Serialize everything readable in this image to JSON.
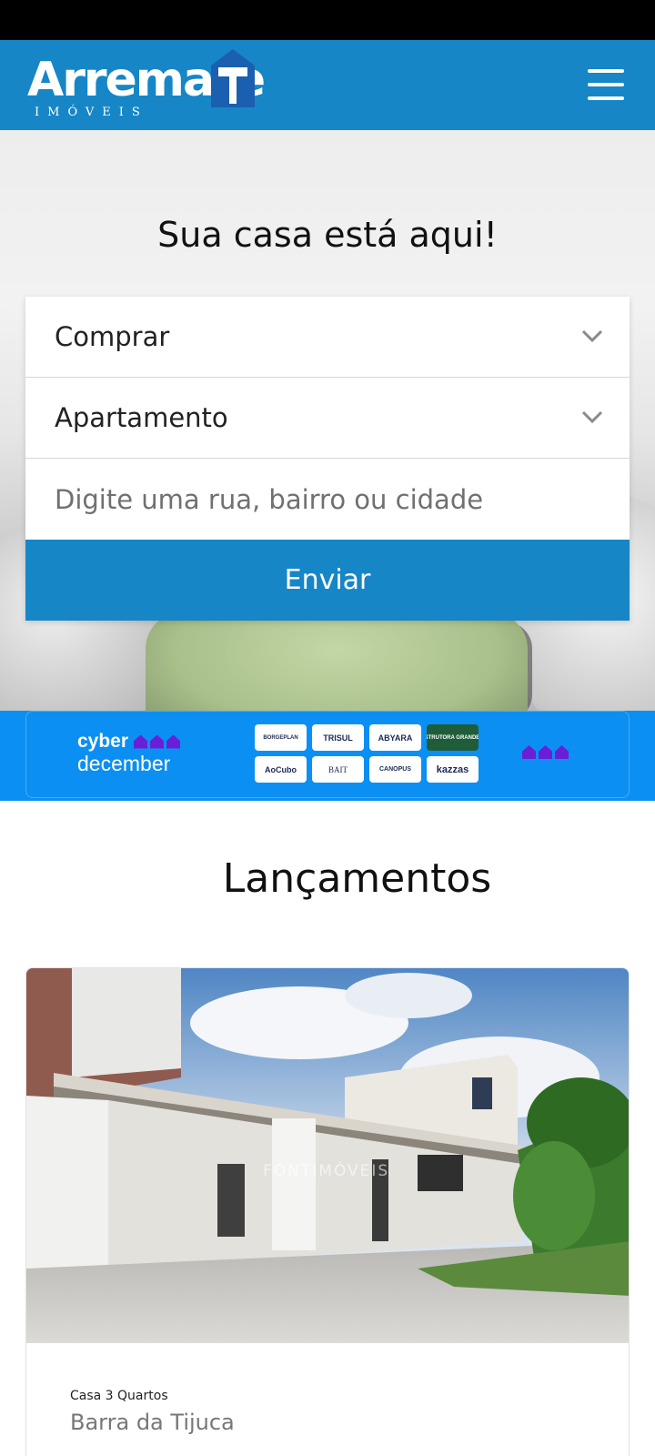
{
  "header": {
    "logo_text": "Arremate",
    "logo_subtext": "IMÓVEIS",
    "brand_color": "#1686c7",
    "menu_icon": "hamburger-menu-icon"
  },
  "hero": {
    "title": "Sua casa está aqui!"
  },
  "search": {
    "transaction_value": "Comprar",
    "property_type_value": "Apartamento",
    "location_placeholder": "Digite uma rua, bairro ou cidade",
    "submit_label": "Enviar"
  },
  "promo": {
    "line1": "cyber",
    "line2": "december",
    "background_color": "#0b8ff2",
    "accent_color": "#6a1fd6",
    "brands": [
      "BORGEPLAN",
      "TRISUL",
      "ABYARA",
      "CONSTRUTORA GRANDE ABC",
      "AoCubo",
      "BAIT",
      "CANOPUS",
      "kazzas"
    ]
  },
  "launches": {
    "section_title": "Lançamentos",
    "listings": [
      {
        "type": "Casa 3 Quartos",
        "location": "Barra da Tijuca",
        "watermark": "FONTIMÓVEIS"
      }
    ]
  }
}
